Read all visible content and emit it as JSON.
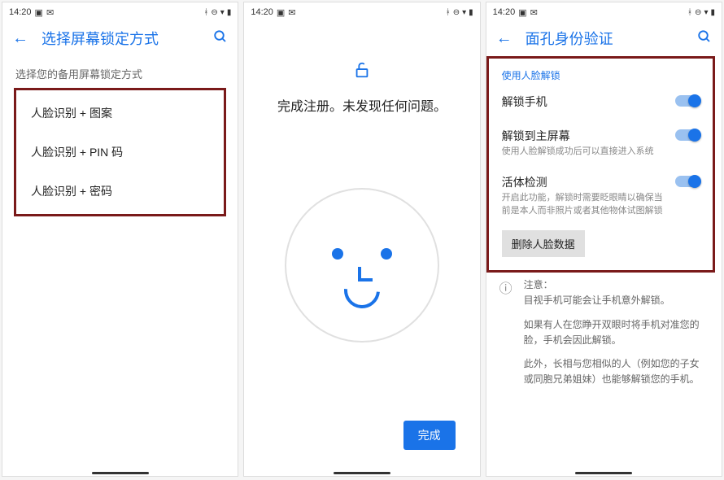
{
  "status": {
    "time": "14:20",
    "icons_left": [
      "gallery-icon",
      "wechat-icon"
    ],
    "icons_right": [
      "bluetooth-icon",
      "dnd-icon",
      "wifi-icon",
      "battery-icon"
    ]
  },
  "screen1": {
    "app_bar_title": "选择屏幕锁定方式",
    "section_label": "选择您的备用屏幕锁定方式",
    "options": [
      "人脸识别 + 图案",
      "人脸识别 + PIN 码",
      "人脸识别 + 密码"
    ]
  },
  "screen2": {
    "message": "完成注册。未发现任何问题。",
    "done_button": "完成"
  },
  "screen3": {
    "app_bar_title": "面孔身份验证",
    "section_header": "使用人脸解锁",
    "settings": [
      {
        "title": "解锁手机",
        "desc": ""
      },
      {
        "title": "解锁到主屏幕",
        "desc": "使用人脸解锁成功后可以直接进入系统"
      },
      {
        "title": "活体检测",
        "desc": "开启此功能，解锁时需要眨眼睛以确保当前是本人而非照片或者其他物体试图解锁"
      }
    ],
    "delete_button": "删除人脸数据",
    "info_heading": "注意：",
    "info_paragraphs": [
      "目视手机可能会让手机意外解锁。",
      "如果有人在您睁开双眼时将手机对准您的脸，手机会因此解锁。",
      "此外，长相与您相似的人（例如您的子女或同胞兄弟姐妹）也能够解锁您的手机。"
    ]
  }
}
